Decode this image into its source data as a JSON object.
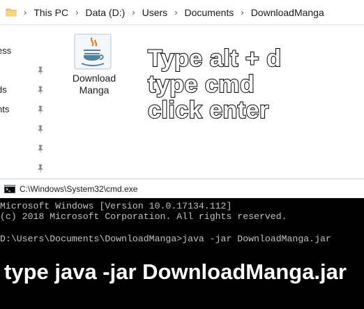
{
  "explorer": {
    "breadcrumbs": [
      "This PC",
      "Data (D:)",
      "Users",
      "Documents",
      "DownloadManga"
    ],
    "nav_items": [
      "ess",
      "",
      "ds",
      "nts",
      "",
      ""
    ],
    "file": {
      "label_line1": "Download",
      "label_line2": "Manga",
      "icon": "java-icon"
    }
  },
  "instructions": {
    "line1": "Type alt + d",
    "line2": "type cmd",
    "line3": "click enter"
  },
  "cmd": {
    "title": "C:\\Windows\\System32\\cmd.exe",
    "lines": [
      "Microsoft Windows [Version 10.0.17134.112]",
      "(c) 2018 Microsoft Corporation. All rights reserved.",
      "",
      "D:\\Users\\Documents\\DownloadManga>java -jar DownloadManga.jar"
    ],
    "caption": "type java -jar DownloadManga.jar"
  },
  "colors": {
    "folder": "#f2c55c",
    "cmd_bg": "#000000",
    "cmd_text": "#c0c0c0"
  }
}
